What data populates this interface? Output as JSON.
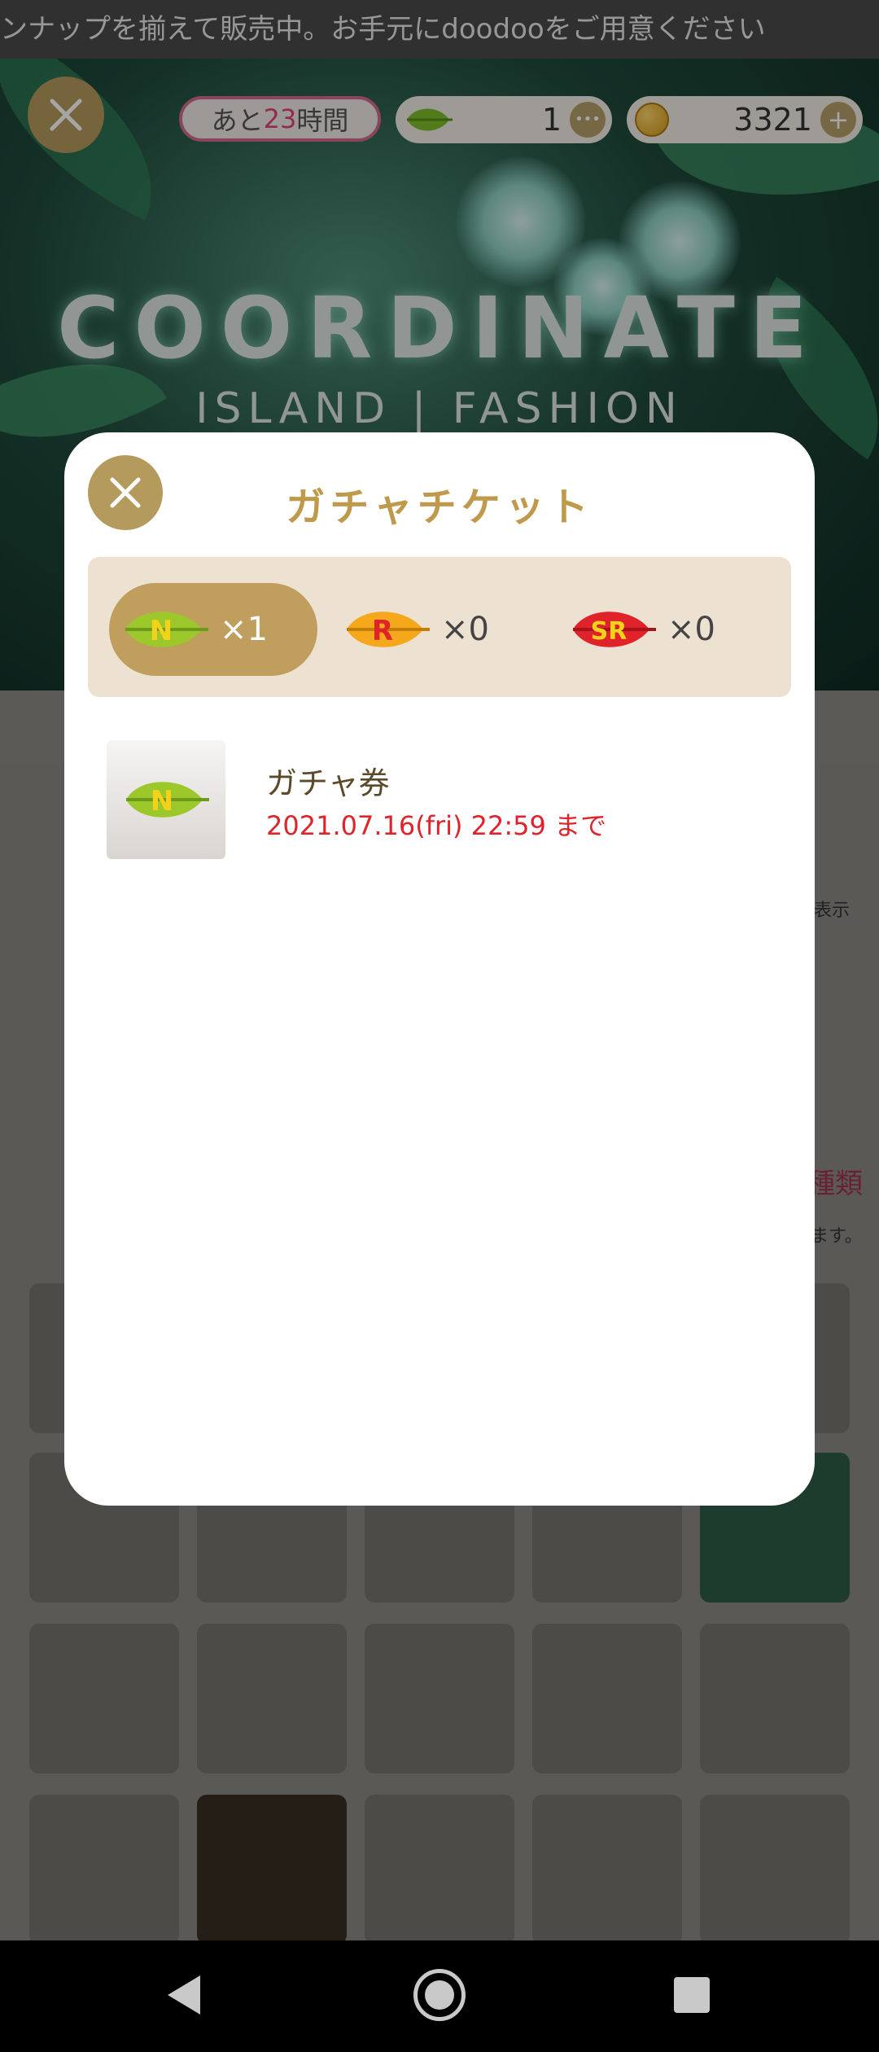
{
  "marquee": {
    "text": "ンナップを揃えて販売中。お手元にdoodooをご用意ください"
  },
  "banner": {
    "title": "COORDINATE",
    "subtitle": "ISLAND | FASHION"
  },
  "header": {
    "timer_prefix": "あと",
    "timer_value": "23",
    "timer_suffix": "時間",
    "leaf_count": "1",
    "coin_count": "3321",
    "more_label": "•••",
    "plus_label": "+"
  },
  "modal": {
    "title": "ガチャチケット",
    "tickets": [
      {
        "rank": "N",
        "count": "×1",
        "color": "#9cc82b",
        "text_color": "#f5d21a",
        "active": true
      },
      {
        "rank": "R",
        "count": "×0",
        "color": "#f5a81c",
        "text_color": "#e0232a",
        "active": false
      },
      {
        "rank": "SR",
        "count": "×0",
        "color": "#e0232a",
        "text_color": "#f5d21a",
        "active": false
      }
    ],
    "item": {
      "name": "ガチャ券",
      "expiry": "2021.07.16(fri) 22:59 まで",
      "icon_rank": "N"
    }
  },
  "background_partial": {
    "right_label": "に表示",
    "kinds_label": "種類",
    "note_label": "ます。"
  },
  "icons": {
    "close": "close-icon",
    "leaf": "leaf-icon",
    "coin": "coin-icon",
    "back": "back-icon",
    "home": "home-icon",
    "recent": "recent-apps-icon"
  },
  "colors": {
    "accent": "#b59a5e",
    "title": "#c09a4c",
    "expiry": "#e0232a",
    "highlight": "#e0447a"
  }
}
